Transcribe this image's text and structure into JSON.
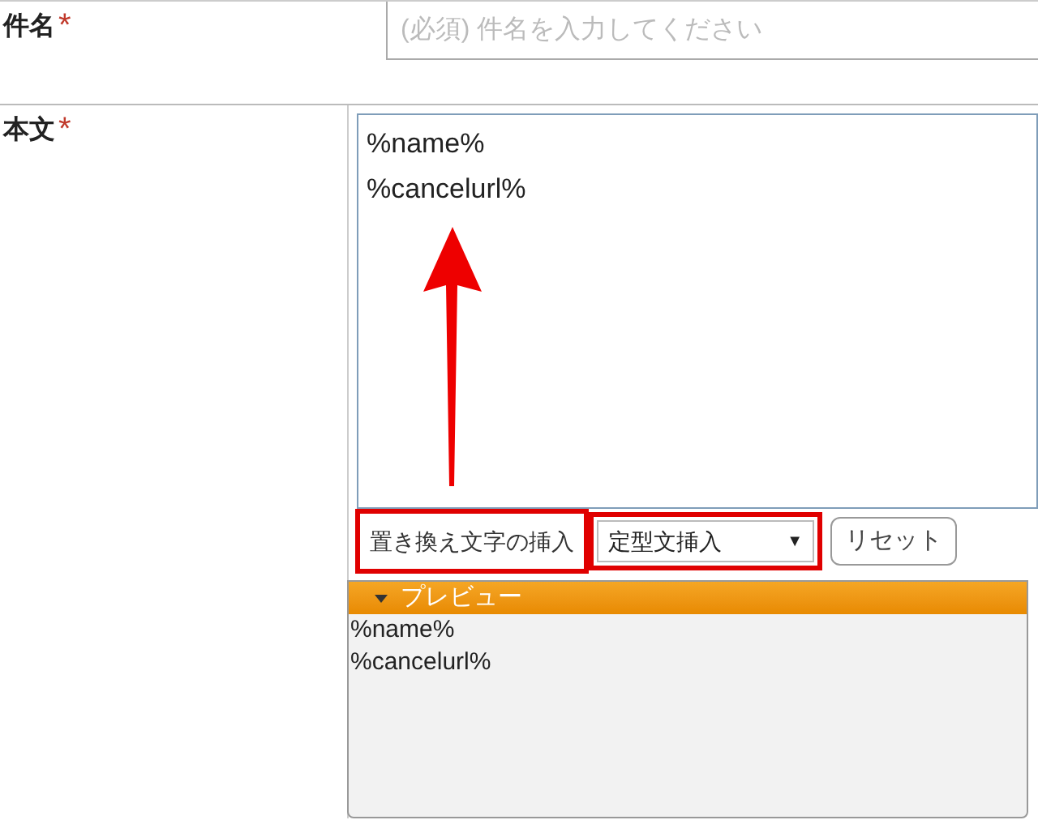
{
  "subject": {
    "label": "件名",
    "required_mark": "*",
    "placeholder": "(必須) 件名を入力してください"
  },
  "body": {
    "label": "本文",
    "required_mark": "*",
    "value": "%name%\n%cancelurl%"
  },
  "controls": [
    {
      "kind": "button",
      "label": "置き換え文字の挿入",
      "highlighted": true
    },
    {
      "kind": "select",
      "label": "定型文挿入",
      "arrow": "▼",
      "highlighted": true
    },
    {
      "kind": "button",
      "label": "リセット",
      "highlighted": false
    }
  ],
  "preview": {
    "title": "プレビュー",
    "expanded": true,
    "lines": [
      "%name%",
      "%cancelurl%"
    ]
  },
  "annotation_arrow": true
}
